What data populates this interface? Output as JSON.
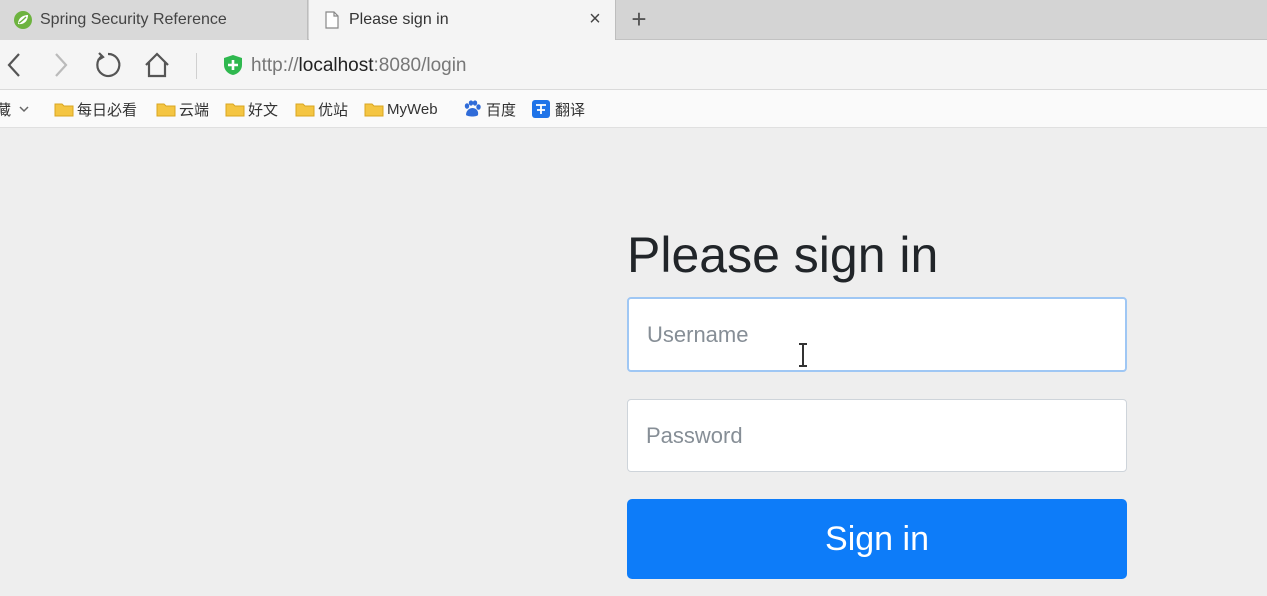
{
  "browser": {
    "tabs": [
      {
        "title": "Spring Security Reference",
        "active": false,
        "icon": "spring-leaf-icon"
      },
      {
        "title": "Please sign in",
        "active": true,
        "icon": "page-icon"
      }
    ],
    "close_glyph": "×",
    "new_tab_glyph": "+",
    "address": {
      "scheme": "http://",
      "host": "localhost",
      "rest": ":8080/login"
    },
    "bookmarks": [
      {
        "label": "藏",
        "icon": "dropdown"
      },
      {
        "label": "每日必看",
        "icon": "folder-icon"
      },
      {
        "label": "云端",
        "icon": "folder-icon"
      },
      {
        "label": "好文",
        "icon": "folder-icon"
      },
      {
        "label": "优站",
        "icon": "folder-icon"
      },
      {
        "label": "MyWeb",
        "icon": "folder-icon"
      },
      {
        "label": "百度",
        "icon": "baidu-paw-icon"
      },
      {
        "label": "翻译",
        "icon": "translate-icon"
      }
    ]
  },
  "login": {
    "heading": "Please sign in",
    "username_placeholder": "Username",
    "password_placeholder": "Password",
    "submit_label": "Sign in"
  },
  "colors": {
    "accent": "#0d7cf9",
    "page_background": "#eeeeee",
    "secure_shield": "#2fb84f"
  }
}
